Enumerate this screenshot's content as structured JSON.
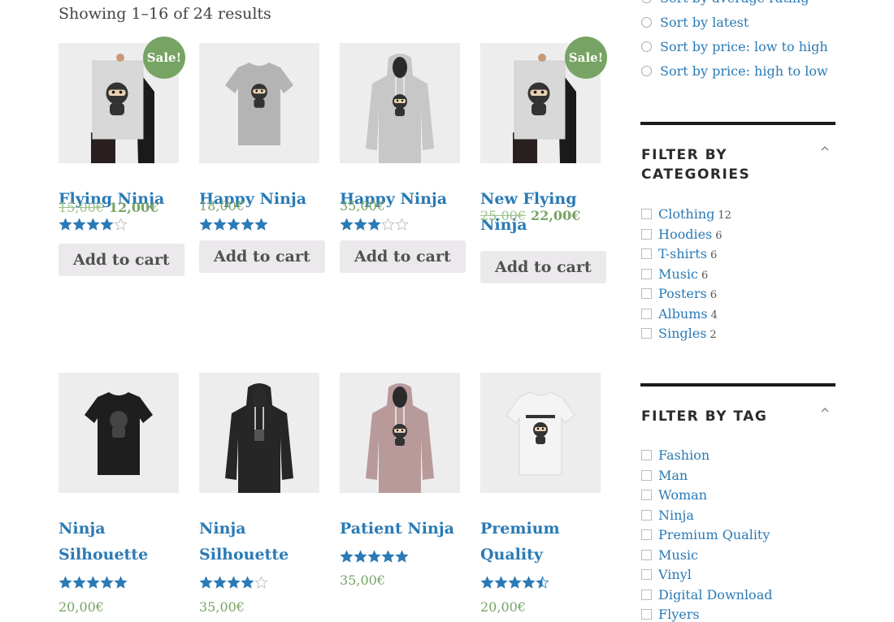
{
  "result_count": "Showing 1–16 of 24 results",
  "sale_label": "Sale!",
  "add_to_cart_label": "Add to cart",
  "colors": {
    "link": "#2a7ab5",
    "price": "#77a464",
    "sale_badge": "#77a464",
    "button_bg": "#ebe9eb",
    "thumb_bg": "#ededed"
  },
  "products": [
    {
      "title_lines": [
        "Flying Ninja",
        ""
      ],
      "rating": 4,
      "old_price": "15,00€",
      "price": "12,00€",
      "on_sale": true,
      "image": "poster-icon"
    },
    {
      "title_lines": [
        "Happy Ninja",
        ""
      ],
      "rating": 5,
      "old_price": "",
      "price": "18,00€",
      "on_sale": false,
      "image": "tshirt-grey-icon"
    },
    {
      "title_lines": [
        "Happy Ninja",
        ""
      ],
      "rating": 3,
      "old_price": "",
      "price": "35,00€",
      "on_sale": false,
      "image": "hoodie-grey-icon"
    },
    {
      "title_lines": [
        "New Flying",
        "Ninja"
      ],
      "rating": 0,
      "old_price": "25,00€",
      "price": "22,00€",
      "on_sale": true,
      "image": "poster-icon"
    },
    {
      "title_lines": [
        "Ninja",
        "Silhouette"
      ],
      "rating": 5,
      "old_price": "",
      "price": "20,00€",
      "on_sale": false,
      "image": "tshirt-black-icon"
    },
    {
      "title_lines": [
        "Ninja",
        "Silhouette"
      ],
      "rating": 4,
      "old_price": "",
      "price": "35,00€",
      "on_sale": false,
      "image": "hoodie-black-icon"
    },
    {
      "title_lines": [
        "Patient Ninja",
        ""
      ],
      "rating": 5,
      "old_price": "",
      "price": "35,00€",
      "on_sale": false,
      "image": "hoodie-pink-icon"
    },
    {
      "title_lines": [
        "Premium",
        "Quality"
      ],
      "rating": 4.5,
      "old_price": "",
      "price": "20,00€",
      "on_sale": false,
      "image": "tshirt-white-icon"
    }
  ],
  "sort_options": [
    "Sort by average rating",
    "Sort by latest",
    "Sort by price: low to high",
    "Sort by price: high to low"
  ],
  "filter_categories": {
    "title_lines": [
      "FILTER BY",
      "CATEGORIES"
    ],
    "items": [
      {
        "label": "Clothing",
        "count": "12"
      },
      {
        "label": "Hoodies",
        "count": "6"
      },
      {
        "label": "T-shirts",
        "count": "6"
      },
      {
        "label": "Music",
        "count": "6"
      },
      {
        "label": "Posters",
        "count": "6"
      },
      {
        "label": "Albums",
        "count": "4"
      },
      {
        "label": "Singles",
        "count": "2"
      }
    ]
  },
  "filter_tags": {
    "title": "FILTER BY TAG",
    "items": [
      "Fashion",
      "Man",
      "Woman",
      "Ninja",
      "Premium Quality",
      "Music",
      "Vinyl",
      "Digital Download",
      "Flyers"
    ]
  }
}
